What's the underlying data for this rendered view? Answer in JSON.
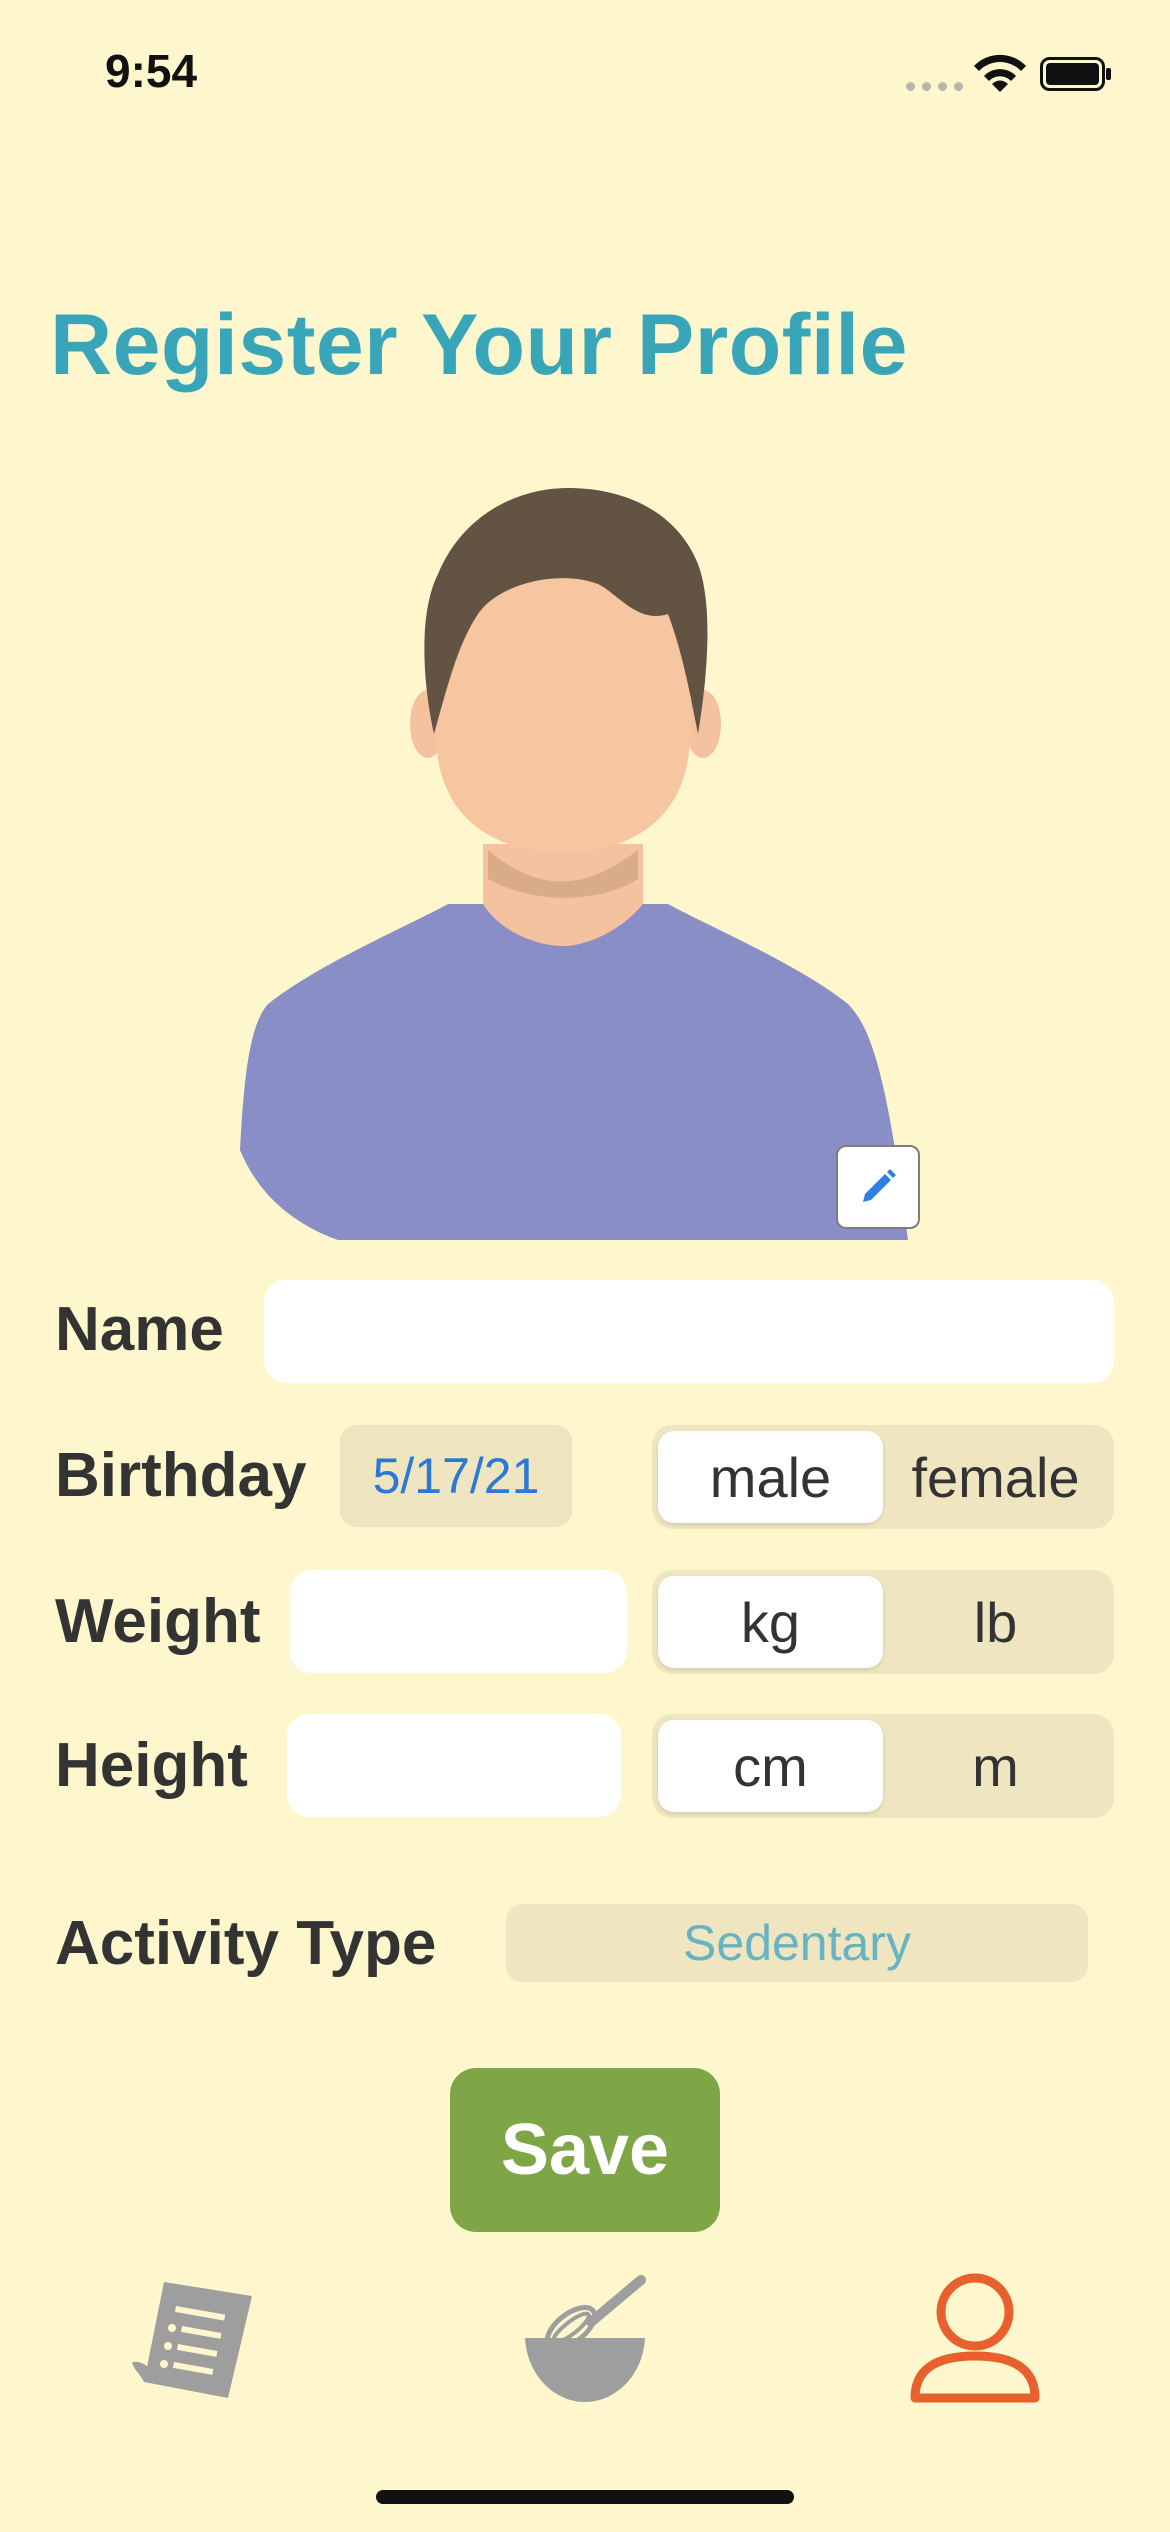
{
  "status_bar": {
    "time": "9:54"
  },
  "page": {
    "title": "Register Your Profile"
  },
  "avatar": {
    "edit_icon": "pencil-icon"
  },
  "form": {
    "name_label": "Name",
    "name_value": "",
    "birthday_label": "Birthday",
    "birthday_value": "5/17/21",
    "gender_options": [
      "male",
      "female"
    ],
    "gender_selected": "male",
    "weight_label": "Weight",
    "weight_value": "",
    "weight_units": [
      "kg",
      "lb"
    ],
    "weight_unit_selected": "kg",
    "height_label": "Height",
    "height_value": "",
    "height_units": [
      "cm",
      "m"
    ],
    "height_unit_selected": "cm",
    "activity_label": "Activity Type",
    "activity_value": "Sedentary",
    "save_label": "Save"
  },
  "tab_bar": {
    "tabs": [
      {
        "icon": "recipe-list-icon",
        "selected": false
      },
      {
        "icon": "whisk-bowl-icon",
        "selected": false
      },
      {
        "icon": "profile-icon",
        "selected": true
      }
    ]
  },
  "colors": {
    "background": "#FEF7CD",
    "title": "#38A6B8",
    "save_button": "#7FA646",
    "active_tab": "#E8602D",
    "inactive_tab": "#9E9E9E",
    "date_text": "#2B79D6",
    "activity_text": "#67B3C2"
  }
}
